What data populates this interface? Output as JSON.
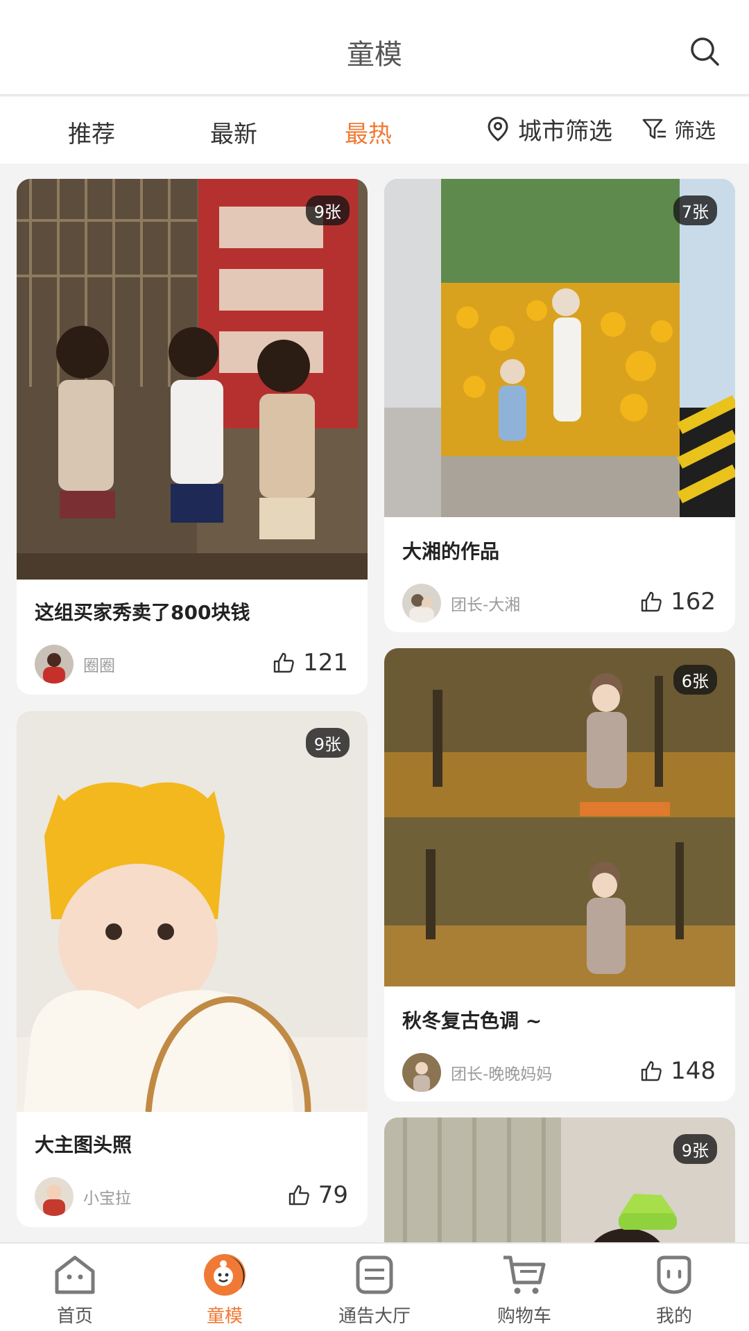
{
  "header": {
    "title": "童模"
  },
  "icons": {
    "search": "search-icon",
    "location": "location-pin-icon",
    "filter": "filter-funnel-icon",
    "like": "thumbs-up-icon"
  },
  "tabs": [
    {
      "label": "推荐"
    },
    {
      "label": "最新"
    },
    {
      "label": "最热"
    }
  ],
  "active_tab": "最热",
  "filters": {
    "city": "城市筛选",
    "filter": "筛选"
  },
  "colors": {
    "accent": "#f07a35"
  },
  "cards": [
    {
      "badge": "9张",
      "title": "这组买家秀卖了800块钱",
      "author": "圈圈",
      "likes": "121"
    },
    {
      "badge": "7张",
      "title": "大湘的作品",
      "author": "团长-大湘",
      "likes": "162"
    },
    {
      "badge": "9张",
      "title": "大主图头照",
      "author": "小宝拉",
      "likes": "79"
    },
    {
      "badge": "6张",
      "title": "秋冬复古色调 ~",
      "author": "团长-晚晚妈妈",
      "likes": "148"
    },
    {
      "badge": "9张"
    }
  ],
  "nav": [
    {
      "label": "首页",
      "icon": "home-icon"
    },
    {
      "label": "童模",
      "icon": "kid-model-icon",
      "active": true
    },
    {
      "label": "通告大厅",
      "icon": "notice-board-icon"
    },
    {
      "label": "购物车",
      "icon": "cart-icon"
    },
    {
      "label": "我的",
      "icon": "profile-icon"
    }
  ]
}
